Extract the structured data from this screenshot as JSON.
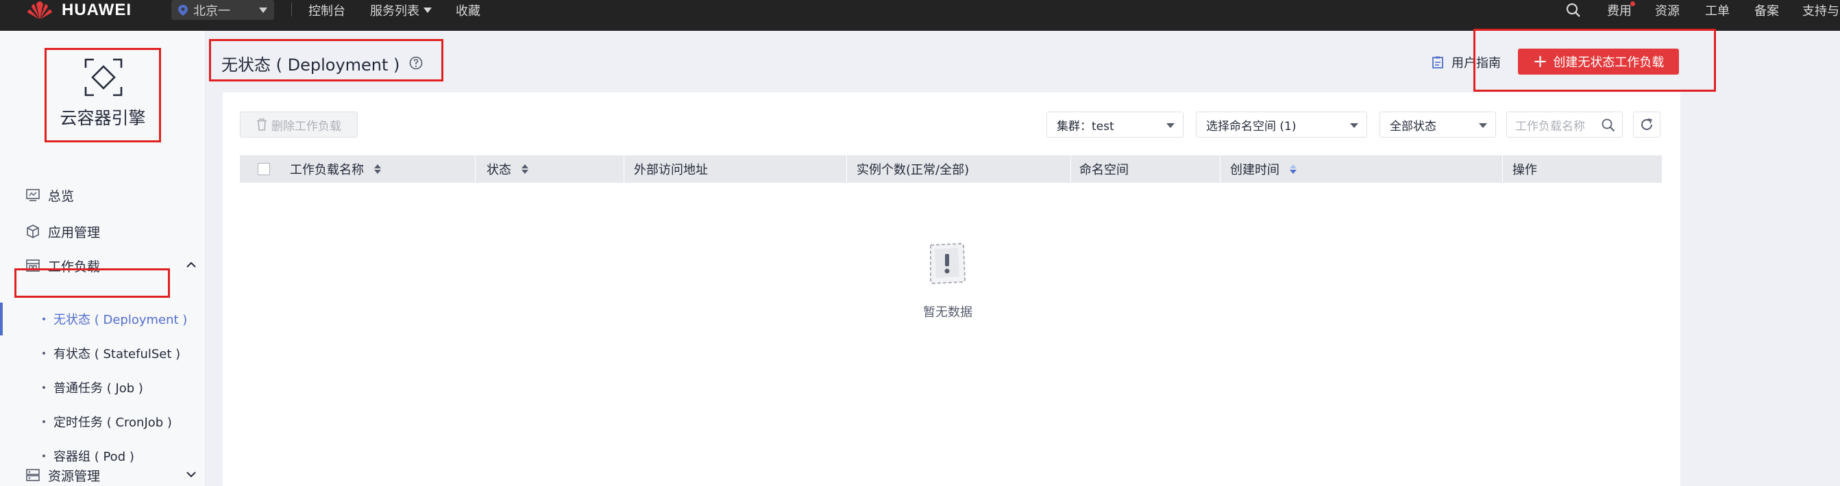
{
  "topbar": {
    "logo_text": "HUAWEI",
    "region": "北京一",
    "nav": [
      "控制台",
      "服务列表",
      "收藏"
    ],
    "right_items": [
      "费用",
      "资源",
      "工单",
      "备案",
      "支持与"
    ]
  },
  "sidebar": {
    "brand_title": "云容器引擎",
    "groups": [
      {
        "label": "总览"
      },
      {
        "label": "应用管理"
      },
      {
        "label": "工作负载"
      },
      {
        "label": "资源管理"
      }
    ],
    "workload_items": [
      {
        "label": "无状态 ( Deployment )"
      },
      {
        "label": "有状态 ( StatefulSet )"
      },
      {
        "label": "普通任务 ( Job )"
      },
      {
        "label": "定时任务 ( CronJob )"
      },
      {
        "label": "容器组 ( Pod )"
      }
    ]
  },
  "header": {
    "title": "无状态 ( Deployment )",
    "guide_label": "用户指南",
    "create_label": "创建无状态工作负载"
  },
  "toolbar": {
    "delete_label": "删除工作负载",
    "cluster_value": "集群：test",
    "namespace_value": "选择命名空间 (1)",
    "status_value": "全部状态",
    "search_placeholder": "工作负载名称"
  },
  "table": {
    "columns": [
      "工作负载名称",
      "状态",
      "外部访问地址",
      "实例个数(正常/全部)",
      "命名空间",
      "创建时间",
      "操作"
    ],
    "rows": []
  },
  "empty_text": "暂无数据",
  "colors": {
    "brand_red": "#e4393c",
    "active_blue": "#526ecc",
    "topbar_bg": "#232323"
  }
}
